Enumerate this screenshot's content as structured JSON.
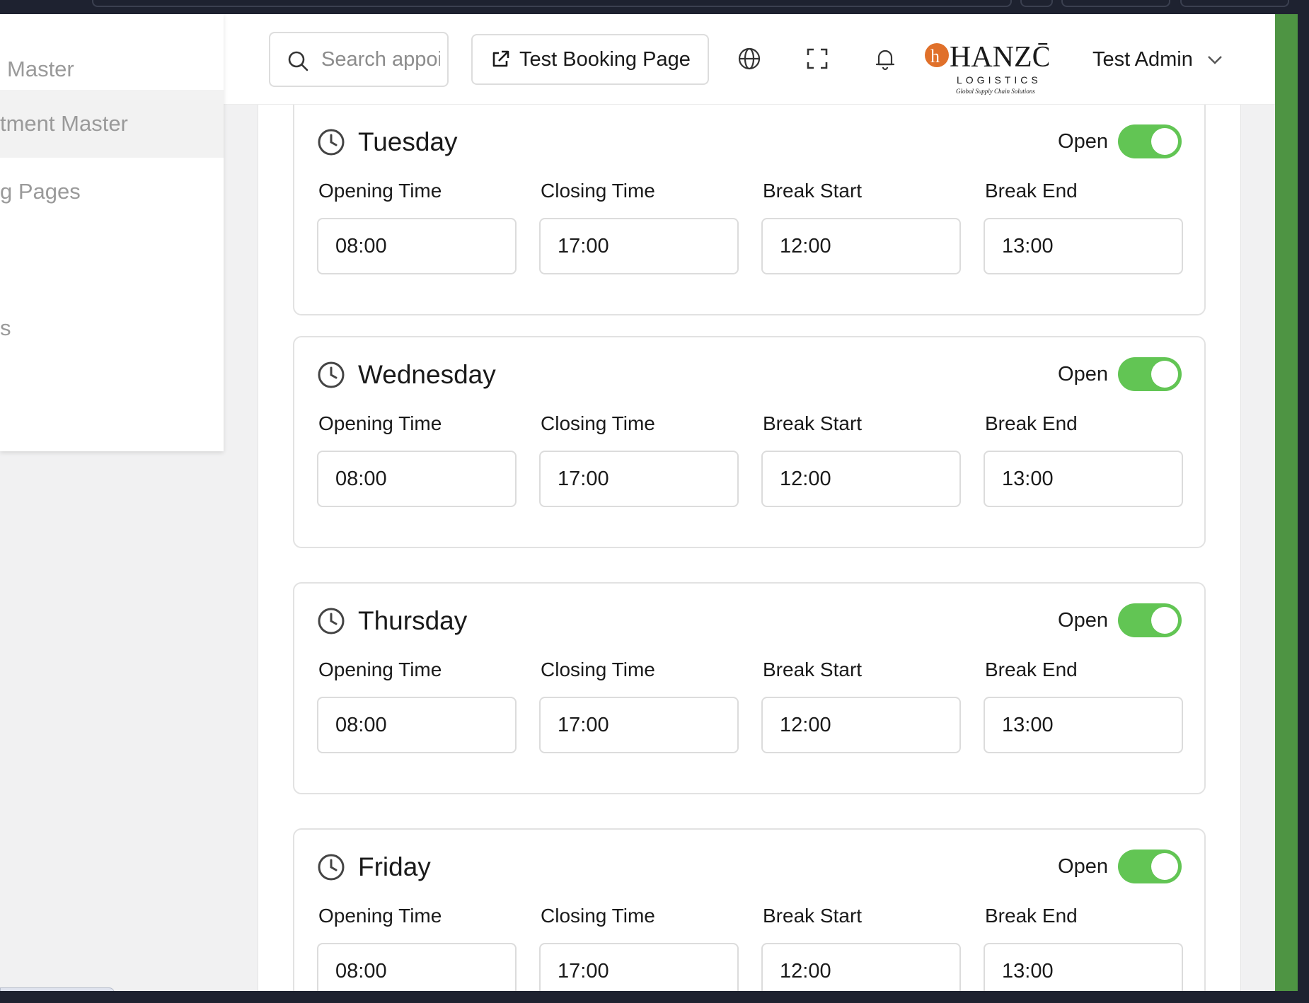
{
  "sidebar": {
    "items": [
      {
        "label": "Master",
        "active": false
      },
      {
        "label": "tment Master",
        "active": true
      },
      {
        "label": "g Pages",
        "active": false
      },
      {
        "label": "s",
        "active": false
      }
    ]
  },
  "header": {
    "search_placeholder": "Search appointments...",
    "test_booking_label": "Test Booking Page",
    "icons": [
      "globe-icon",
      "fullscreen-icon",
      "bell-icon"
    ],
    "logo": {
      "name": "HANZŌ",
      "sub": "LOGISTICS",
      "tagline": "Global Supply Chain Solutions"
    },
    "user_name": "Test Admin"
  },
  "field_labels": {
    "opening": "Opening Time",
    "closing": "Closing Time",
    "break_start": "Break Start",
    "break_end": "Break End"
  },
  "days": [
    {
      "name": "Tuesday",
      "status": "Open",
      "is_open": true,
      "opening": "08:00",
      "closing": "17:00",
      "break_start": "12:00",
      "break_end": "13:00"
    },
    {
      "name": "Wednesday",
      "status": "Open",
      "is_open": true,
      "opening": "08:00",
      "closing": "17:00",
      "break_start": "12:00",
      "break_end": "13:00"
    },
    {
      "name": "Thursday",
      "status": "Open",
      "is_open": true,
      "opening": "08:00",
      "closing": "17:00",
      "break_start": "12:00",
      "break_end": "13:00"
    },
    {
      "name": "Friday",
      "status": "Open",
      "is_open": true,
      "opening": "08:00",
      "closing": "17:00",
      "break_start": "12:00",
      "break_end": "13:00"
    }
  ],
  "status_url": "tment-master",
  "colors": {
    "toggle_on": "#62c554",
    "green_strip": "#4e9443",
    "accent_orange": "#e0702a"
  }
}
